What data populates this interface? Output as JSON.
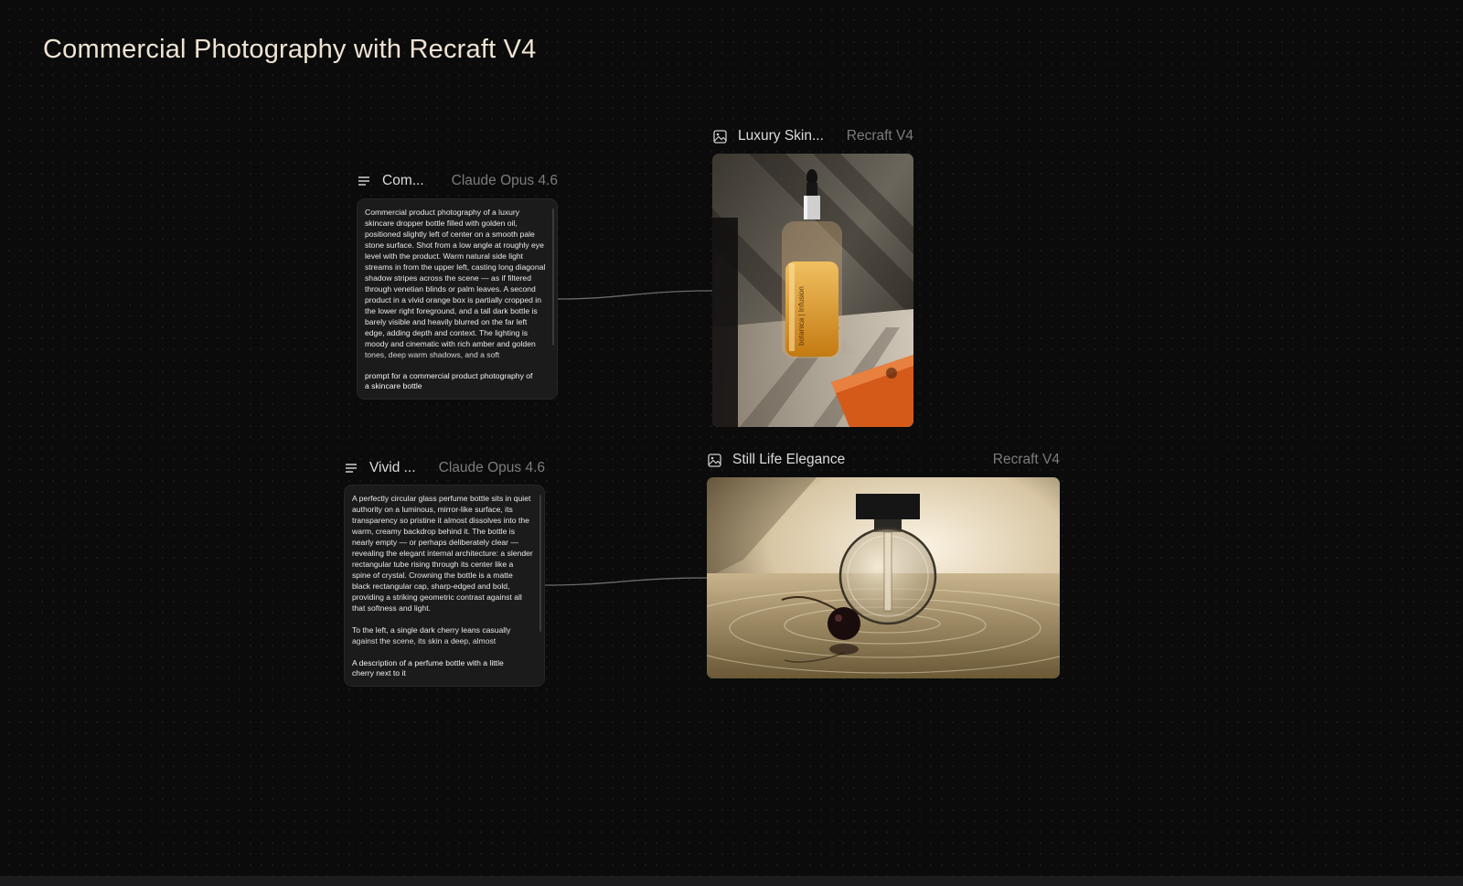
{
  "page": {
    "title": "Commercial Photography with Recraft V4"
  },
  "nodes": {
    "prompt1": {
      "name": "Com...",
      "model": "Claude Opus 4.6",
      "text": "Commercial product photography of a luxury skincare dropper bottle filled with golden oil, positioned slightly left of center on a smooth pale stone surface. Shot from a low angle at roughly eye level with the product. Warm natural side light streams in from the upper left, casting long diagonal shadow stripes across the scene — as if filtered through venetian blinds or palm leaves. A second product in a vivid orange box is partially cropped in the lower right foreground, and a tall dark bottle is barely visible and heavily blurred on the far left edge, adding depth and context. The lighting is moody and cinematic with rich amber and golden tones, deep warm shadows, and a soft",
      "caption": "prompt for a commercial product photography of a skincare bottle"
    },
    "prompt2": {
      "name": "Vivid ...",
      "model": "Claude Opus 4.6",
      "text": "A perfectly circular glass perfume bottle sits in quiet authority on a luminous, mirror-like surface, its transparency so pristine it almost dissolves into the warm, creamy backdrop behind it. The bottle is nearly empty — or perhaps deliberately clear — revealing the elegant internal architecture: a slender rectangular tube rising through its center like a spine of crystal. Crowning the bottle is a matte black rectangular cap, sharp-edged and bold, providing a striking geometric contrast against all that softness and light.\n\nTo the left, a single dark cherry leans casually against the scene, its skin a deep, almost",
      "caption": "A description of a perfume bottle with a little cherry next to it"
    },
    "image1": {
      "name": "Luxury Skin...",
      "model": "Recraft V4",
      "label_text": "botanica | Infusion"
    },
    "image2": {
      "name": "Still Life Elegance",
      "model": "Recraft V4"
    }
  },
  "icons": {
    "text_node": "text-lines-icon",
    "image_node": "image-icon"
  },
  "colors": {
    "background": "#0b0b0b",
    "title": "#efe3d3",
    "node_name": "#dcdcdc",
    "model_label": "#7c7c7c",
    "card": "#1b1b1b"
  }
}
